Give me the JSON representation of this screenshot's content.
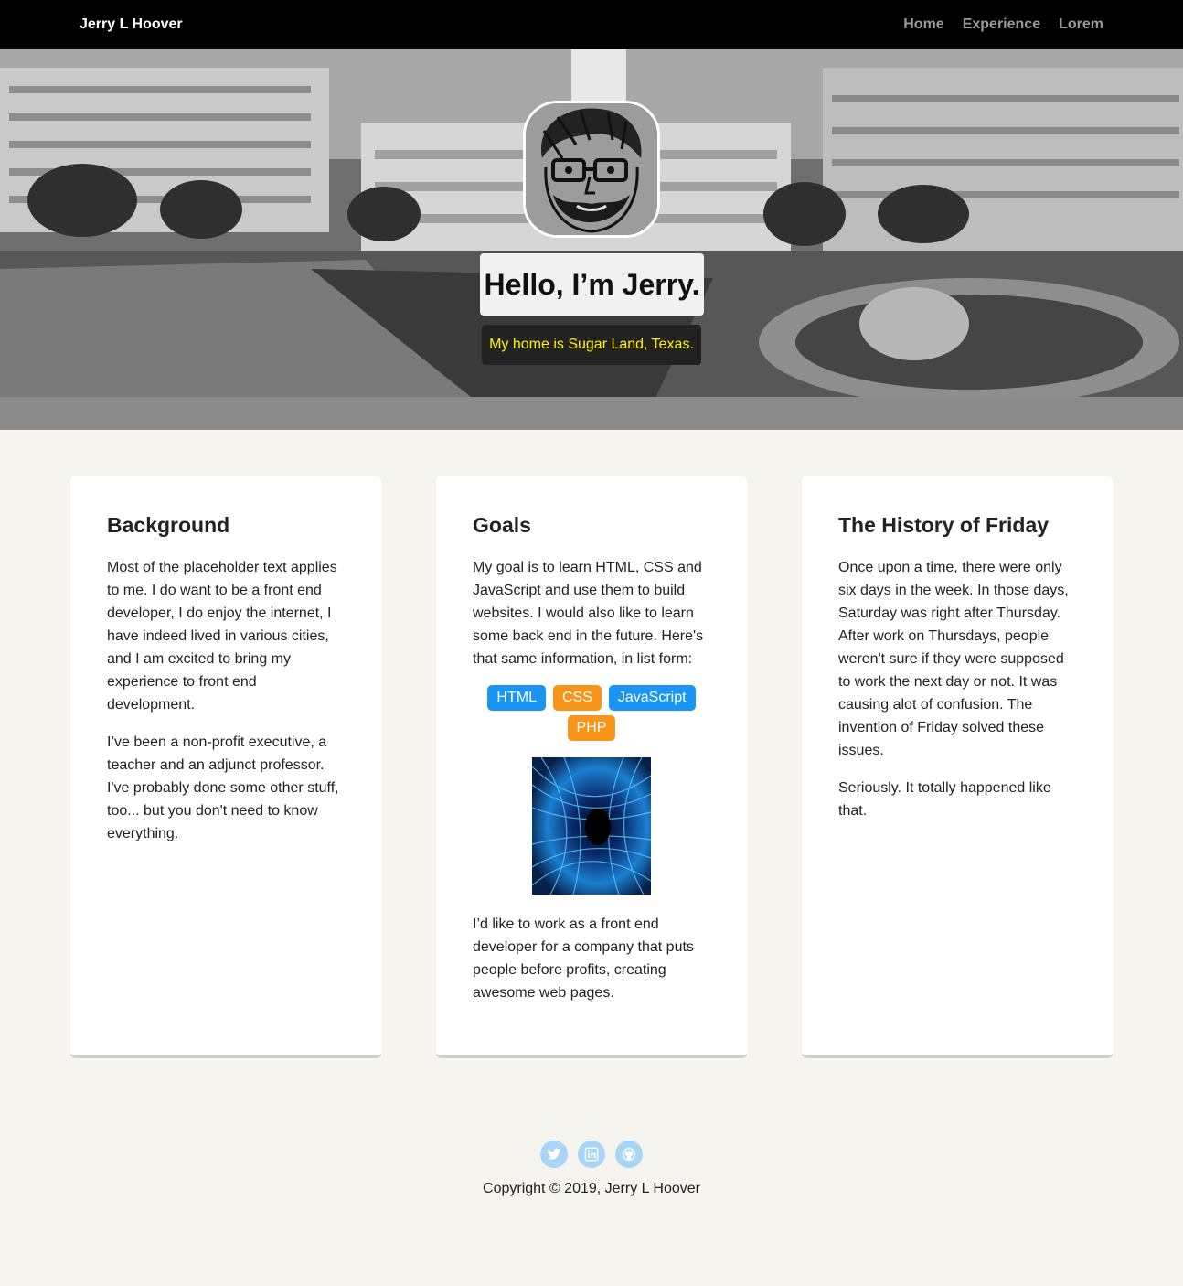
{
  "nav": {
    "brand": "Jerry L Hoover",
    "links": [
      "Home",
      "Experience",
      "Lorem"
    ]
  },
  "hero": {
    "title": "Hello, I’m Jerry.",
    "subtitle": "My home is Sugar Land, Texas."
  },
  "cards": {
    "background": {
      "title": "Background",
      "p1": "Most of the placeholder text applies to me. I do want to be a front end developer, I do enjoy the internet, I have indeed lived in various cities, and I am excited to bring my experience to front end development.",
      "p2": "I’ve been a non-profit executive, a teacher and an adjunct professor. I've probably done some other stuff, too... but you don't need to know everything."
    },
    "goals": {
      "title": "Goals",
      "p1": "My goal is to learn HTML, CSS and JavaScript and use them to build websites. I would also like to learn some back end in the future. Here's that same information, in list form:",
      "tags": [
        "HTML",
        "CSS",
        "JavaScript",
        "PHP"
      ],
      "p2": "I’d like to work as a front end developer for a company that puts people before profits, creating awesome web pages."
    },
    "friday": {
      "title": "The History of Friday",
      "p1": "Once upon a time, there were only six days in the week. In those days, Saturday was right after Thursday. After work on Thursdays, people weren't sure if they were supposed to work the next day or not. It was causing alot of confusion. The invention of Friday solved these issues.",
      "p2": "Seriously. It totally happened like that."
    }
  },
  "footer": {
    "icons": [
      "twitter-icon",
      "linkedin-icon",
      "github-icon"
    ],
    "copyright": "Copyright © 2019, Jerry L Hoover"
  },
  "colors": {
    "nav_bg": "#000000",
    "page_bg": "#f5f4ef",
    "tag_blue": "#1a95f3",
    "tag_orange": "#f7951a",
    "subtitle_text": "#fff200",
    "social_bg": "#a9d6f6"
  }
}
